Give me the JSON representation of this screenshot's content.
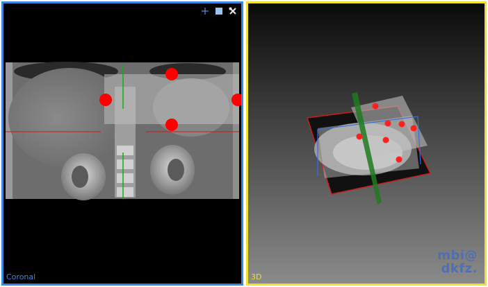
{
  "views": {
    "coronal": {
      "label": "Coronal",
      "border_color": "#3a86e0"
    },
    "render3d": {
      "label": "3D",
      "border_color": "#f2e02a"
    }
  },
  "toolbar": {
    "icons": [
      "crosshair-icon",
      "maximize-icon",
      "tools-icon"
    ]
  },
  "logo": {
    "line1": "mbi@",
    "line2": "dkfz."
  },
  "landmarks": {
    "color": "#ff0000",
    "count_2d": 4,
    "count_3d": 7
  },
  "crosshair": {
    "horizontal_color": "#c81e1e",
    "vertical_color": "#1fa51f",
    "frame_3d_color": "#3a6fd8"
  }
}
